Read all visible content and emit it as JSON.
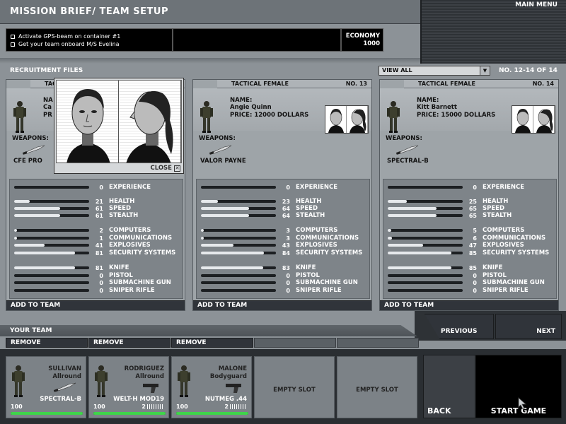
{
  "header": {
    "title": "MISSION BRIEF/ TEAM SETUP",
    "main_menu": "MAIN MENU",
    "objectives": [
      "Activate GPS-beam on container #1",
      "Get your team onboard M/S Evelina"
    ],
    "economy_label": "ECONOMY",
    "economy_value": "1000"
  },
  "recruitment": {
    "label": "RECRUITMENT FILES",
    "view_filter": "VIEW ALL",
    "range": "NO. 12-14 OF 14"
  },
  "cards": [
    {
      "category": "TAC",
      "number": "",
      "name_label": "NA",
      "name": "Ca",
      "price_label": "PR",
      "weapons_label": "WEAPONS:",
      "weapon": "CFE PRO",
      "stats": [
        {
          "label": "EXPERIENCE",
          "value": 0
        },
        {
          "label": "HEALTH",
          "value": 21
        },
        {
          "label": "SPEED",
          "value": 61
        },
        {
          "label": "STEALTH",
          "value": 61
        },
        {
          "label": "COMPUTERS",
          "value": 2
        },
        {
          "label": "COMMUNICATIONS",
          "value": 1
        },
        {
          "label": "EXPLOSIVES",
          "value": 41
        },
        {
          "label": "SECURITY SYSTEMS",
          "value": 81
        },
        {
          "label": "KNIFE",
          "value": 81
        },
        {
          "label": "PISTOL",
          "value": 0
        },
        {
          "label": "SUBMACHINE GUN",
          "value": 0
        },
        {
          "label": "SNIPER RIFLE",
          "value": 0
        }
      ],
      "add_label": "ADD TO TEAM"
    },
    {
      "category": "TACTICAL FEMALE",
      "number": "NO. 13",
      "name_label": "NAME:",
      "name": "Angie Quinn",
      "price_label": "PRICE: 12000 DOLLARS",
      "weapons_label": "WEAPONS:",
      "weapon": "VALOR PAYNE",
      "stats": [
        {
          "label": "EXPERIENCE",
          "value": 0
        },
        {
          "label": "HEALTH",
          "value": 23
        },
        {
          "label": "SPEED",
          "value": 64
        },
        {
          "label": "STEALTH",
          "value": 64
        },
        {
          "label": "COMPUTERS",
          "value": 3
        },
        {
          "label": "COMMUNICATIONS",
          "value": 3
        },
        {
          "label": "EXPLOSIVES",
          "value": 43
        },
        {
          "label": "SECURITY SYSTEMS",
          "value": 84
        },
        {
          "label": "KNIFE",
          "value": 83
        },
        {
          "label": "PISTOL",
          "value": 0
        },
        {
          "label": "SUBMACHINE GUN",
          "value": 0
        },
        {
          "label": "SNIPER RIFLE",
          "value": 0
        }
      ],
      "add_label": "ADD TO TEAM"
    },
    {
      "category": "TACTICAL FEMALE",
      "number": "NO. 14",
      "name_label": "NAME:",
      "name": "Kitt Barnett",
      "price_label": "PRICE: 15000 DOLLARS",
      "weapons_label": "WEAPONS:",
      "weapon": "SPECTRAL-B",
      "stats": [
        {
          "label": "EXPERIENCE",
          "value": 0
        },
        {
          "label": "HEALTH",
          "value": 25
        },
        {
          "label": "SPEED",
          "value": 65
        },
        {
          "label": "STEALTH",
          "value": 65
        },
        {
          "label": "COMPUTERS",
          "value": 5
        },
        {
          "label": "COMMUNICATIONS",
          "value": 6
        },
        {
          "label": "EXPLOSIVES",
          "value": 47
        },
        {
          "label": "SECURITY SYSTEMS",
          "value": 85
        },
        {
          "label": "KNIFE",
          "value": 85
        },
        {
          "label": "PISTOL",
          "value": 0
        },
        {
          "label": "SUBMACHINE GUN",
          "value": 0
        },
        {
          "label": "SNIPER RIFLE",
          "value": 0
        }
      ],
      "add_label": "ADD TO TEAM"
    }
  ],
  "popup": {
    "close_label": "CLOSE"
  },
  "team": {
    "label": "YOUR TEAM",
    "remove_label": "REMOVE",
    "previous": "PREVIOUS",
    "next": "NEXT",
    "members": [
      {
        "name": "SULLIVAN",
        "role": "Allround",
        "weapon": "SPECTRAL-B",
        "health": "100",
        "ammo": ""
      },
      {
        "name": "RODRIGUEZ",
        "role": "Allround",
        "weapon": "WELT-H MOD19",
        "health": "100",
        "ammo": "2"
      },
      {
        "name": "MALONE",
        "role": "Bodyguard",
        "weapon": "NUTMEG .44",
        "health": "100",
        "ammo": "2"
      }
    ],
    "empty_slot": "EMPTY SLOT",
    "back": "BACK",
    "start": "START GAME"
  },
  "colors": {
    "health_bar": "#3fd44a",
    "panel": "#9ea4a8",
    "button": "#30343a"
  },
  "icons": [
    "soldier-icon",
    "knife-icon",
    "pistol-icon",
    "close-icon",
    "chevron-down-icon",
    "mouse-cursor-icon"
  ]
}
